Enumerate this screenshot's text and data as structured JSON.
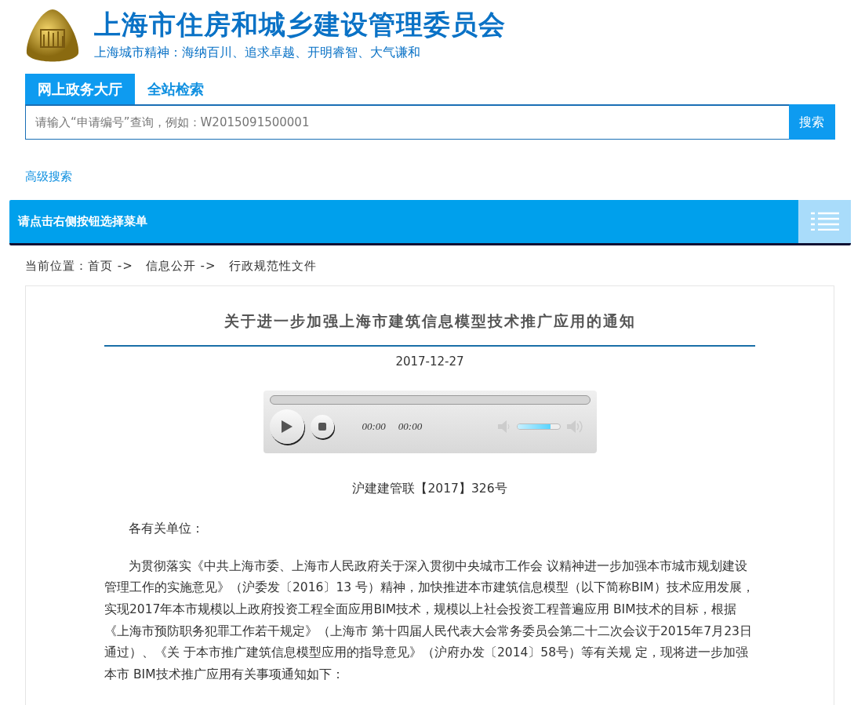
{
  "header": {
    "title": "上海市住房和城乡建设管理委员会",
    "slogan": "上海城市精神：海纳百川、追求卓越、开明睿智、大气谦和"
  },
  "search_tabs": [
    {
      "label": "网上政务大厅",
      "selected": true
    },
    {
      "label": "全站检索",
      "selected": false
    }
  ],
  "search": {
    "placeholder": "请输入“申请编号”查询，例如：W2015091500001",
    "button": "搜索"
  },
  "advanced_search": "高级搜索",
  "menu_bar": {
    "label": "请点击右侧按钮选择菜单"
  },
  "breadcrumb": [
    "当前位置：首页 ->",
    "信息公开 ->",
    "行政规范性文件"
  ],
  "article": {
    "title": "关于进一步加强上海市建筑信息模型技术推广应用的通知",
    "date": "2017-12-27",
    "player": {
      "current_time": "00:00",
      "total_time": "00:00",
      "volume": {
        "level": 0.78
      }
    },
    "doc_number": "沪建建管联【2017】326号",
    "salutation": "各有关单位：",
    "paragraphs": [
      "为贯彻落实《中共上海市委、上海市人民政府关于深入贯彻中央城市工作会 议精神进一步加强本市城市规划建设管理工作的实施意见》（沪委发〔2016〕13 号）精神，加快推进本市建筑信息模型（以下简称BIM）技术应用发展，实现2017年本市规模以上政府投资工程全面应用BIM技术，规模以上社会投资工程普遍应用 BIM技术的目标，根据《上海市预防职务犯罪工作若干规定》（上海市 第十四届人民代表大会常务委员会第二十二次会议于2015年7月23日通过）、《关 于本市推广建筑信息模型应用的指导意见》（沪府办发〔2014〕58号）等有关规 定，现将进一步加强本市 BIM技术推广应用有关事项通知如下："
    ]
  }
}
